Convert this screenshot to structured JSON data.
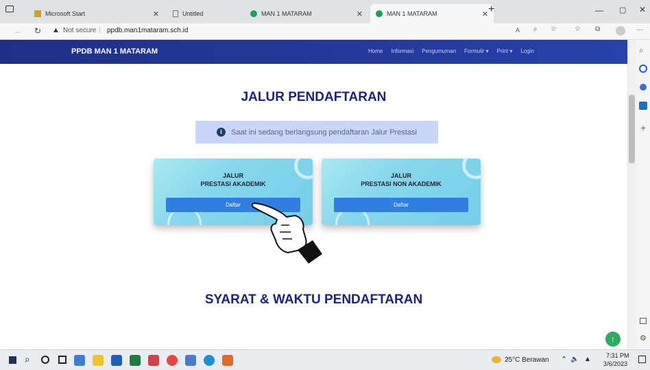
{
  "browser": {
    "tabs": [
      {
        "label": "Microsoft Start",
        "active": false
      },
      {
        "label": "Untitled",
        "active": false
      },
      {
        "label": "MAN 1 MATARAM",
        "active": false
      },
      {
        "label": "MAN 1 MATARAM",
        "active": true
      }
    ],
    "new_tab": "+",
    "security_label": "Not secure",
    "url": "ppdb.man1mataram.sch.id"
  },
  "site": {
    "brand": "PPDB MAN 1 MATARAM",
    "menu": [
      "Home",
      "Informasi",
      "Pengumuman",
      "Formulir ▾",
      "Print ▾",
      "Login"
    ]
  },
  "main": {
    "title": "JALUR PENDAFTARAN",
    "notice": "Saat ini sedang berlangsung pendaftaran Jalur Prestasi",
    "cards": [
      {
        "line1": "JALUR",
        "line2": "PRESTASI AKADEMIK",
        "button": "Daftar"
      },
      {
        "line1": "JALUR",
        "line2": "PRESTASI NON AKADEMIK",
        "button": "Daftar"
      }
    ],
    "section2_title": "SYARAT & WAKTU PENDAFTARAN"
  },
  "taskbar": {
    "weather": "25°C Berawan",
    "time": "7:31 PM",
    "date": "3/6/2023"
  },
  "colors": {
    "navbar": "#2742a8",
    "heading": "#1a237e",
    "button": "#2f7fe0",
    "notice_bg": "#c9d6fb"
  }
}
